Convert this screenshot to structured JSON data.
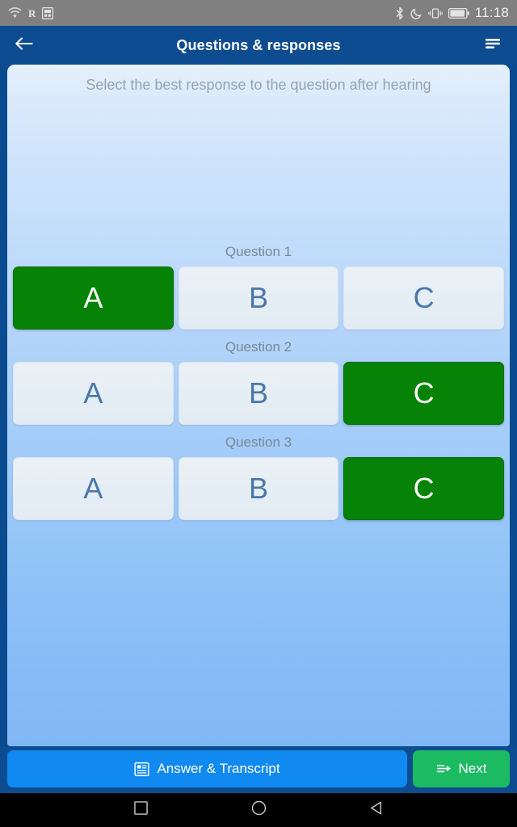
{
  "status_bar": {
    "icons_left": [
      "wifi-icon",
      "roaming-indicator",
      "sim-card-icon"
    ],
    "roaming_label": "R",
    "icons_right": [
      "bluetooth-icon",
      "do-not-disturb-icon",
      "vibrate-icon",
      "battery-icon"
    ],
    "time": "11:18",
    "background": "#808080"
  },
  "app_bar": {
    "back_icon": "arrow-left-icon",
    "title": "Questions & responses",
    "menu_icon": "menu-icon",
    "background": "#0d4c91"
  },
  "content": {
    "instruction": "Select the best response to the question after hearing"
  },
  "questions": [
    {
      "label": "Question 1",
      "choices": [
        {
          "label": "A",
          "selected": true
        },
        {
          "label": "B",
          "selected": false
        },
        {
          "label": "C",
          "selected": false
        }
      ]
    },
    {
      "label": "Question 2",
      "choices": [
        {
          "label": "A",
          "selected": false
        },
        {
          "label": "B",
          "selected": false
        },
        {
          "label": "C",
          "selected": true
        }
      ]
    },
    {
      "label": "Question 3",
      "choices": [
        {
          "label": "A",
          "selected": false
        },
        {
          "label": "B",
          "selected": false
        },
        {
          "label": "C",
          "selected": true
        }
      ]
    }
  ],
  "action_bar": {
    "transcript_label": "Answer & Transcript",
    "transcript_icon": "article-icon",
    "transcript_color": "#1089f0",
    "next_label": "Next",
    "next_icon": "arrow-forward-icon",
    "next_color": "#1cbb62"
  },
  "nav_bar": {
    "recents_icon": "square-icon",
    "home_icon": "circle-icon",
    "back_icon": "triangle-back-icon"
  },
  "colors": {
    "selected_green": "#068206",
    "unselected_bg": "#e6eef6",
    "unselected_text": "#4a77a8",
    "primary_blue": "#0d4c91"
  }
}
